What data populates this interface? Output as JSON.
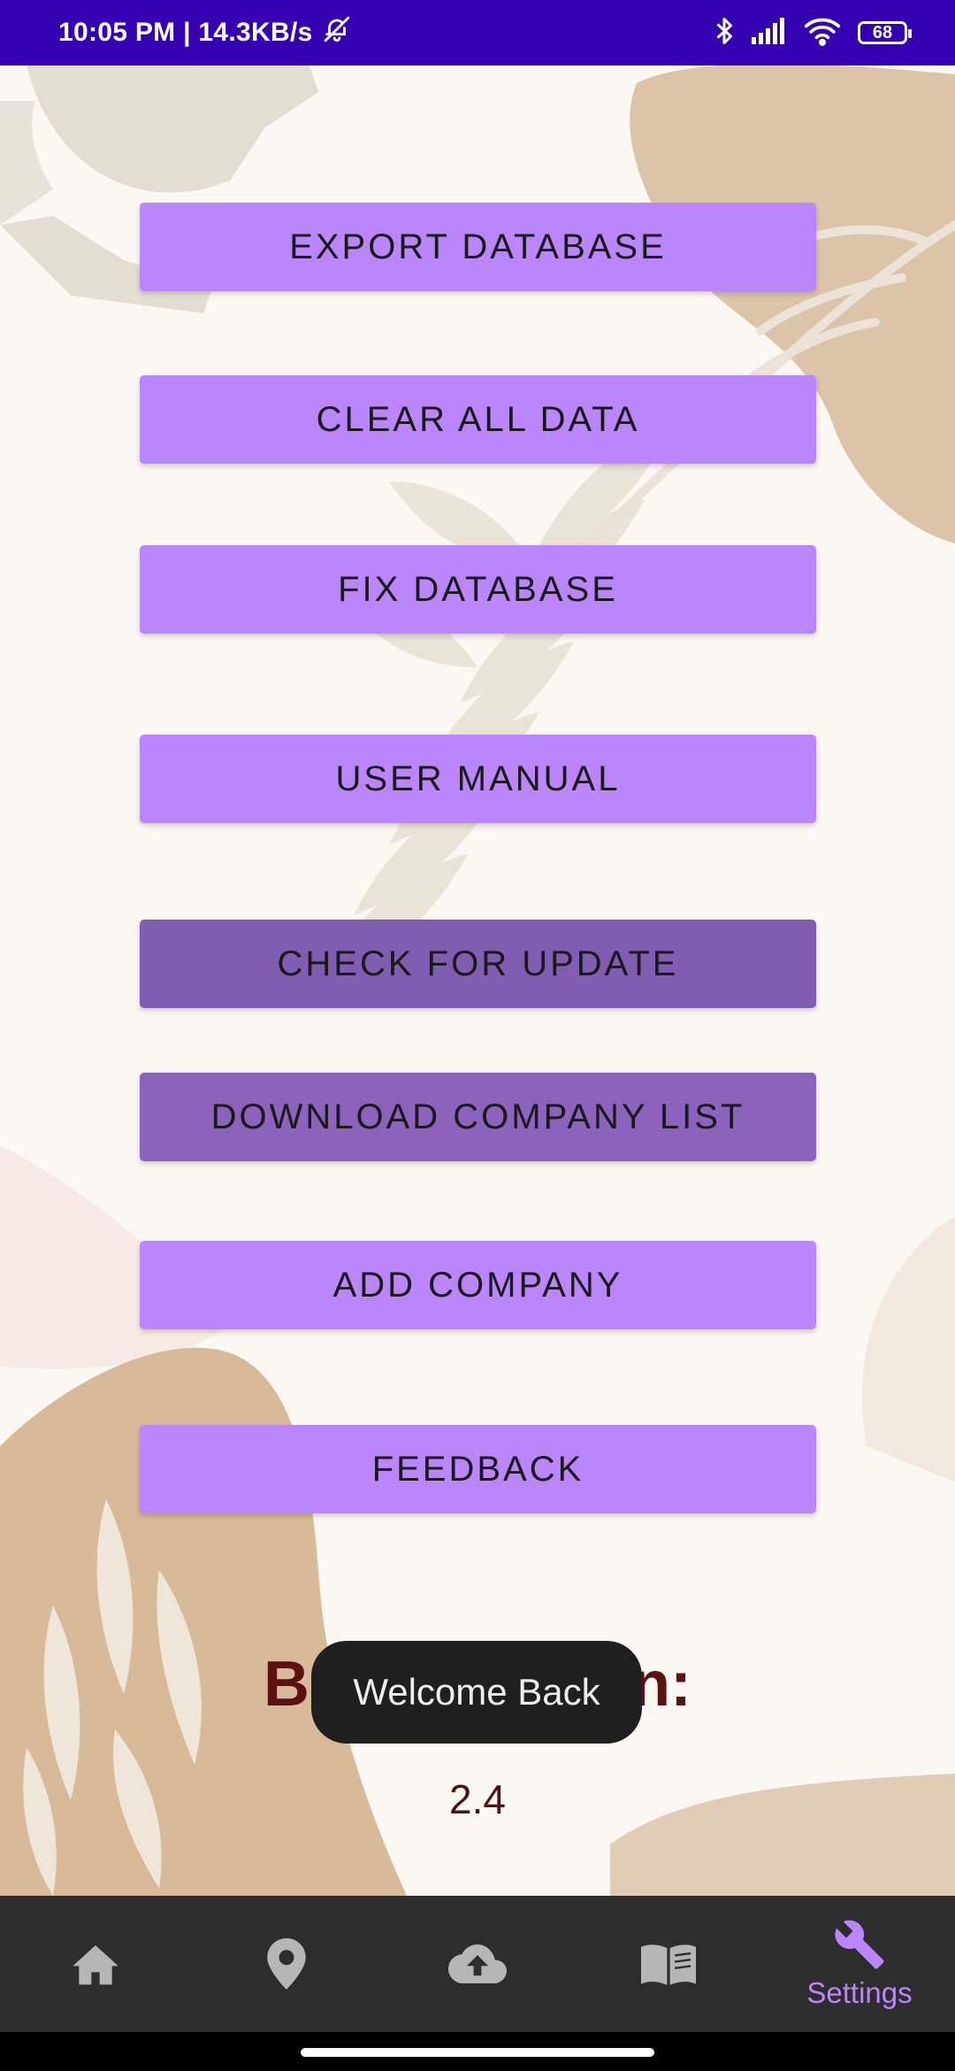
{
  "status_bar": {
    "time_speed": "10:05 PM | 14.3KB/s",
    "battery": "68",
    "icons": [
      "mute-bell-icon",
      "bluetooth-icon",
      "signal-icon",
      "wifi-icon",
      "battery-icon"
    ]
  },
  "buttons": [
    {
      "label": "EXPORT DATABASE"
    },
    {
      "label": "CLEAR ALL DATA"
    },
    {
      "label": "FIX DATABASE"
    },
    {
      "label": "USER MANUAL"
    },
    {
      "label": "CHECK FOR UPDATE"
    },
    {
      "label": "DOWNLOAD COMPANY LIST"
    },
    {
      "label": "ADD COMPANY"
    },
    {
      "label": "FEEDBACK"
    }
  ],
  "version": {
    "title": "Build Version:",
    "value": "2.4"
  },
  "toast": {
    "text": "Welcome Back"
  },
  "bottom_nav": {
    "items": [
      {
        "icon": "home-icon",
        "label": ""
      },
      {
        "icon": "location-pin-icon",
        "label": ""
      },
      {
        "icon": "cloud-upload-icon",
        "label": ""
      },
      {
        "icon": "book-icon",
        "label": ""
      },
      {
        "icon": "wrench-icon",
        "label": "Settings"
      }
    ],
    "active_index": 4
  },
  "colors": {
    "status_bar": "#3400b2",
    "button": "#bb86fc",
    "button_pressed": "#7f5db0",
    "nav_background": "#2d2d2d",
    "accent": "#bb86fc",
    "version_text": "#5c1212"
  }
}
